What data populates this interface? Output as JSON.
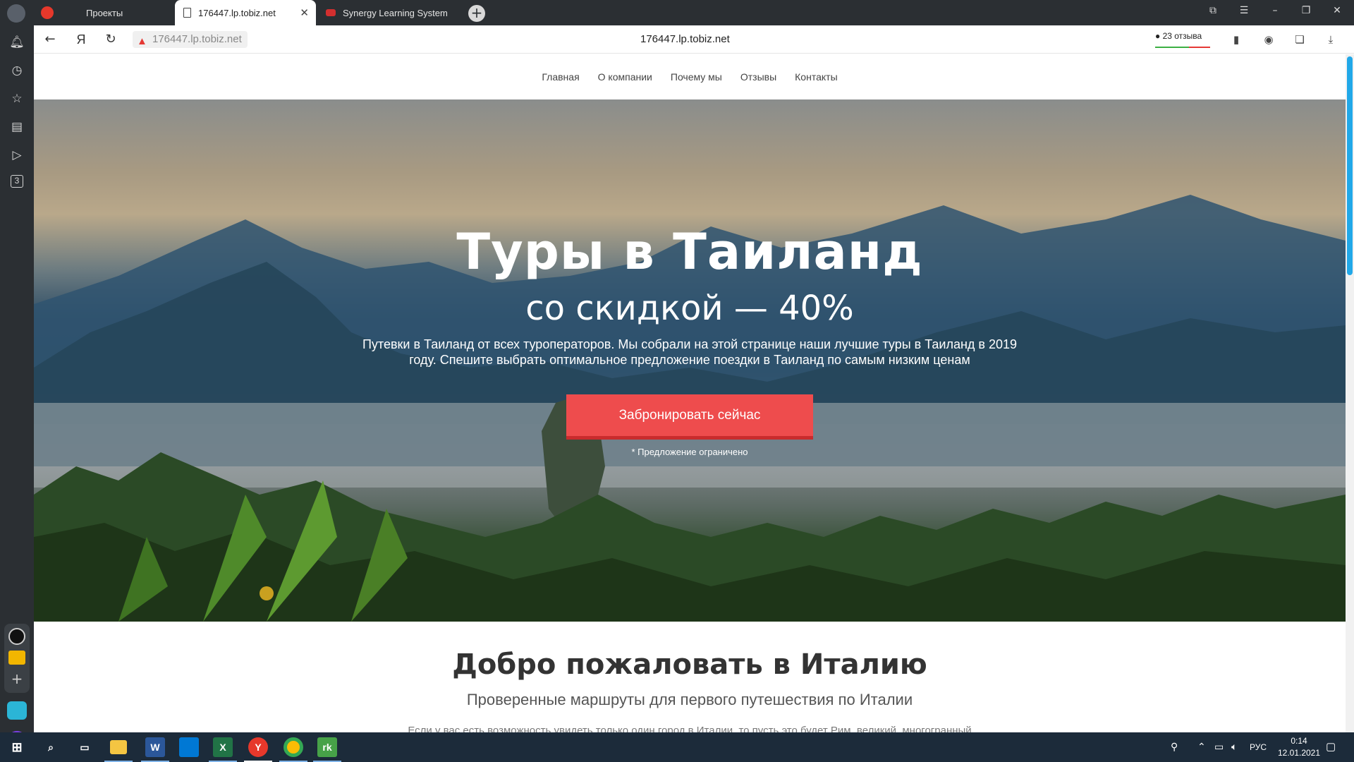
{
  "browser": {
    "tabs": [
      {
        "label": "Проекты",
        "active": false
      },
      {
        "label": "176447.lp.tobiz.net",
        "active": true
      },
      {
        "label": "Synergy Learning System",
        "active": false
      }
    ],
    "address_chip": "176447.lp.tobiz.net",
    "address_center": "176447.lp.tobiz.net",
    "reviews_badge": "23 отзыва",
    "yandex_glyph": "Я",
    "side_badge": "3"
  },
  "site": {
    "nav": [
      "Главная",
      "О компании",
      "Почему мы",
      "Отзывы",
      "Контакты"
    ],
    "hero": {
      "title": "Туры в Таиланд",
      "subtitle": "со скидкой — 40%",
      "description": "Путевки в Таиланд от всех туроператоров. Мы собрали на этой странице наши лучшие туры в Таиланд в 2019 году. Спешите выбрать оптимальное предложение поездки в Таиланд по самым низким ценам",
      "cta": "Забронировать сейчас",
      "note": "* Предложение ограничено"
    },
    "section": {
      "title": "Добро пожаловать в Италию",
      "subtitle": "Проверенные маршруты для первого путешествия по Италии",
      "text_partial": "Если у вас есть возможность увидеть только один город в Италии, то пусть это будет Рим, великий, многогранный"
    }
  },
  "taskbar": {
    "language": "РУС",
    "time": "0:14",
    "date": "12.01.2021"
  },
  "colors": {
    "cta": "#ee4c4d",
    "scroll_accent": "#21a8e8",
    "chrome_dark": "#2b2f33",
    "taskbar": "#1c2b3a"
  }
}
